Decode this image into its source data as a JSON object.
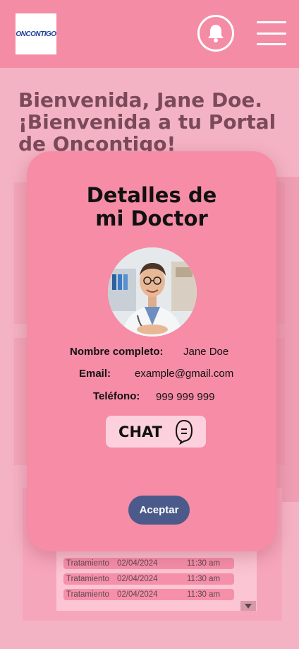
{
  "header": {
    "logo_text": "ONCONTIGO",
    "bell_icon": "bell-icon",
    "menu_icon": "hamburger-menu-icon"
  },
  "welcome": {
    "line1": "Bienvenida, Jane Doe.",
    "line2": "¡Bienvenida a tu Portal",
    "line3": "de Oncontigo!"
  },
  "appointments": [
    {
      "type": "Tratamiento",
      "date": "02/04/2024",
      "time": "11:30 am"
    },
    {
      "type": "Tratamiento",
      "date": "02/04/2024",
      "time": "11:30 am"
    },
    {
      "type": "Tratamiento",
      "date": "02/04/2024",
      "time": "11:30 am"
    }
  ],
  "modal": {
    "title_line1": "Detalles de",
    "title_line2": "mi Doctor",
    "name_label": "Nombre completo:",
    "name_value": "Jane Doe",
    "email_label": "Email:",
    "email_value": "example@gmail.com",
    "phone_label": "Teléfono:",
    "phone_value": "999 999 999",
    "chat_label": "CHAT",
    "chat_icon": "chat-bubble-icon",
    "accept_label": "Aceptar"
  },
  "colors": {
    "header": "#f58ca6",
    "modal": "#f68ca6",
    "accept_button": "#4b5a8a",
    "page_bg": "#f4b3c4"
  }
}
